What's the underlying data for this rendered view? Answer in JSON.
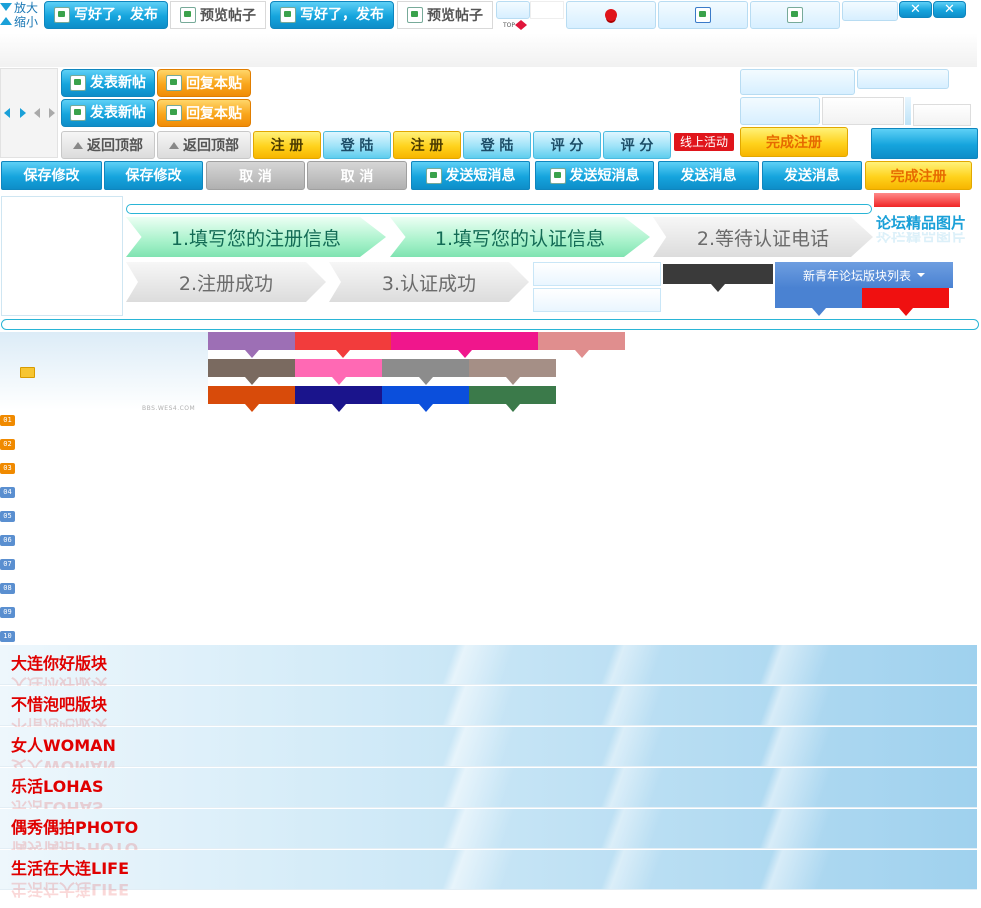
{
  "zoom": {
    "enlarge": "放大",
    "shrink": "缩小"
  },
  "toolbar_top": {
    "publish": "写好了，发布",
    "preview": "预览帖子",
    "publish2": "写好了，发布",
    "preview2": "预览帖子",
    "top_label": "TOP"
  },
  "post_buttons": {
    "new_post": "发表新帖",
    "reply": "回复本贴",
    "new_post2": "发表新帖",
    "reply2": "回复本贴",
    "back_top": "返回顶部",
    "back_top2": "返回顶部"
  },
  "auth_buttons": {
    "register": "注 册",
    "login": "登 陆",
    "register2": "注 册",
    "login2": "登 陆",
    "rate": "评 分",
    "rate2": "评 分",
    "online_activity": "线上活动",
    "complete_register": "完成注册",
    "complete_register2": "完成注册"
  },
  "action_buttons": {
    "save": "保存修改",
    "save2": "保存修改",
    "cancel": "取 消",
    "cancel2": "取 消",
    "send_sms": "发送短消息",
    "send_sms2": "发送短消息",
    "send_msg": "发送消息",
    "send_msg2": "发送消息"
  },
  "steps": {
    "s1": "1.填写您的注册信息",
    "s2": "1.填写您的认证信息",
    "s3": "2.等待认证电话",
    "s4": "2.注册成功",
    "s5": "3.认证成功"
  },
  "forum": {
    "featured_images": "论坛精品图片",
    "board_list": "新青年论坛版块列表",
    "watermark": "BBS.WES4.COM"
  },
  "numbers": [
    "01",
    "02",
    "03",
    "04",
    "05",
    "06",
    "07",
    "08",
    "09",
    "10"
  ],
  "boards": [
    "大连你好版块",
    "不惜泡吧版块",
    "女人WOMAN",
    "乐活LOHAS",
    "偶秀偶拍PHOTO",
    "生活在大连LIFE"
  ],
  "colors": {
    "swatch_row1": [
      "#9d6fb5",
      "#f23c3c",
      "#f0168c",
      "#e08e8e"
    ],
    "swatch_row2": [
      "#7a6a60",
      "#ff69b4",
      "#8c8c8c",
      "#a58f86"
    ],
    "swatch_row3": [
      "#d84b0a",
      "#1a148c",
      "#0b4fdc",
      "#3b7a4a"
    ],
    "num_orange": "#f08a00",
    "num_blue": "#5a8fd0"
  }
}
